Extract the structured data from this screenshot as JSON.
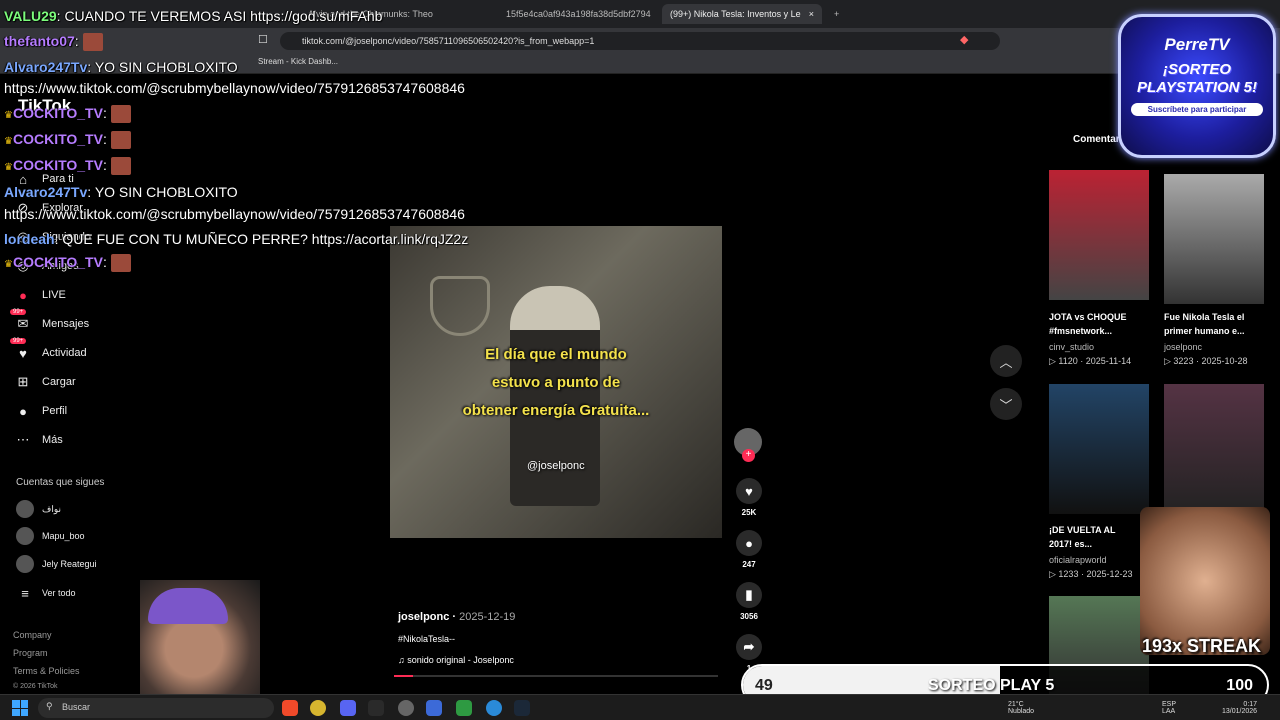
{
  "browser": {
    "tabs": [
      {
        "label": "Alvin and the Chipmunks: Theo",
        "active": false
      },
      {
        "label": "15f5e4ca0af943a198fa38d5dbf2794",
        "active": false
      },
      {
        "label": "(99+) Nikola Tesla: Inventos y Le",
        "active": true
      }
    ],
    "url": "tiktok.com/@joselponc/video/7585711096506502420?is_from_webapp=1",
    "bookmarks": [
      "Stream - Kick Dashb..."
    ]
  },
  "tiktok": {
    "logo": "TikTok",
    "nav": [
      {
        "icon": "home-icon",
        "glyph": "⌂",
        "label": "Para ti",
        "badge": ""
      },
      {
        "icon": "compass-icon",
        "glyph": "⊘",
        "label": "Explorar",
        "badge": ""
      },
      {
        "icon": "following-icon",
        "glyph": "◎",
        "label": "Siguiendo",
        "badge": ""
      },
      {
        "icon": "friends-icon",
        "glyph": "◎",
        "label": "Amigos",
        "badge": ""
      },
      {
        "icon": "live-icon",
        "glyph": "●",
        "label": "LIVE",
        "badge": ""
      },
      {
        "icon": "messages-icon",
        "glyph": "✉",
        "label": "Mensajes",
        "badge": "99+"
      },
      {
        "icon": "activity-icon",
        "glyph": "♥",
        "label": "Actividad",
        "badge": "99+"
      },
      {
        "icon": "upload-icon",
        "glyph": "⊞",
        "label": "Cargar",
        "badge": ""
      },
      {
        "icon": "profile-icon",
        "glyph": "●",
        "label": "Perfil",
        "badge": ""
      },
      {
        "icon": "more-icon",
        "glyph": "⋯",
        "label": "Más",
        "badge": ""
      }
    ],
    "following_title": "Cuentas que sigues",
    "following": [
      "نواف",
      "Mapu_boo",
      "Jely Reategui"
    ],
    "see_all": "Ver todo",
    "footer": [
      "Company",
      "Program",
      "Terms & Policies",
      "© 2026 TikTok"
    ],
    "video": {
      "caption_lines": [
        "El día que el mundo",
        "estuvo a punto de",
        "obtener energía Gratuita..."
      ],
      "watermark": "@joselponc",
      "author": "joselponc",
      "date": "2025-12-19",
      "hashtags": "#NikolaTesla--",
      "sound": "sonido original - Joselponc",
      "progress": 0.06
    },
    "actions": {
      "likes": "25K",
      "comments": "247",
      "saves": "3056",
      "shares": "1"
    },
    "right": {
      "comments_tab": "Comentarios",
      "cards": [
        {
          "title_1": "JOTA vs CHOQUE",
          "title_2": "#fmsnetwork...",
          "author": "cinv_studio",
          "views": "1120",
          "date": "2025-11-14"
        },
        {
          "title_1": "Fue Nikola Tesla el",
          "title_2": "primer humano e...",
          "author": "joselponc",
          "views": "3223",
          "date": "2025-10-28"
        },
        {
          "title_1": "¡DE VUELTA AL",
          "title_2": "2017! es...",
          "author": "oficialrapworld",
          "views": "1233",
          "date": "2025-12-23"
        }
      ]
    }
  },
  "chat": [
    {
      "user": "VALU29",
      "color": "#7cfc7c",
      "crown": false,
      "text": "CUANDO TE VEREMOS ASI https://god.su/mFAhb",
      "emote": false
    },
    {
      "user": "thefanto07",
      "color": "#b67cff",
      "crown": false,
      "text": "",
      "emote": true
    },
    {
      "user": "Alvaro247Tv",
      "color": "#7aa8ff",
      "crown": false,
      "text": "YO SIN CHOBLOXITO",
      "emote": false
    },
    {
      "user": "",
      "color": "#fff",
      "crown": false,
      "text": "https://www.tiktok.com/@scrubmybellaynow/video/7579126853747608846",
      "emote": false
    },
    {
      "user": "COCKITO_TV",
      "color": "#b67cff",
      "crown": true,
      "text": "",
      "emote": true
    },
    {
      "user": "COCKITO_TV",
      "color": "#b67cff",
      "crown": true,
      "text": "",
      "emote": true
    },
    {
      "user": "COCKITO_TV",
      "color": "#b67cff",
      "crown": true,
      "text": "",
      "emote": true
    },
    {
      "user": "Alvaro247Tv",
      "color": "#7aa8ff",
      "crown": false,
      "text": "YO SIN CHOBLOXITO",
      "emote": false
    },
    {
      "user": "",
      "color": "#fff",
      "crown": false,
      "text": "https://www.tiktok.com/@scrubmybellaynow/video/7579126853747608846",
      "emote": false
    },
    {
      "user": "lordeah",
      "color": "#7aa8ff",
      "crown": false,
      "text": "QUE FUE CON TU MUÑECO PERRE? https://acortar.link/rqJZ2z",
      "emote": false
    },
    {
      "user": "COCKITO_TV",
      "color": "#b67cff",
      "crown": true,
      "text": "",
      "emote": true
    }
  ],
  "overlay": {
    "brand": "PerreTV",
    "promo_line_1": "¡SORTEO",
    "promo_line_2": "PLAYSTATION 5!",
    "promo_cta": "Suscríbete para participar",
    "streak": "193x STREAK",
    "goal": {
      "current": "49",
      "label": "SORTEO PLAY 5",
      "target": "100",
      "fraction": 0.49
    }
  },
  "taskbar": {
    "search": "Buscar",
    "weather": "21°C",
    "weather_desc": "Nublado",
    "lang_1": "ESP",
    "lang_2": "LAA",
    "time": "0:17",
    "date": "13/01/2026"
  }
}
